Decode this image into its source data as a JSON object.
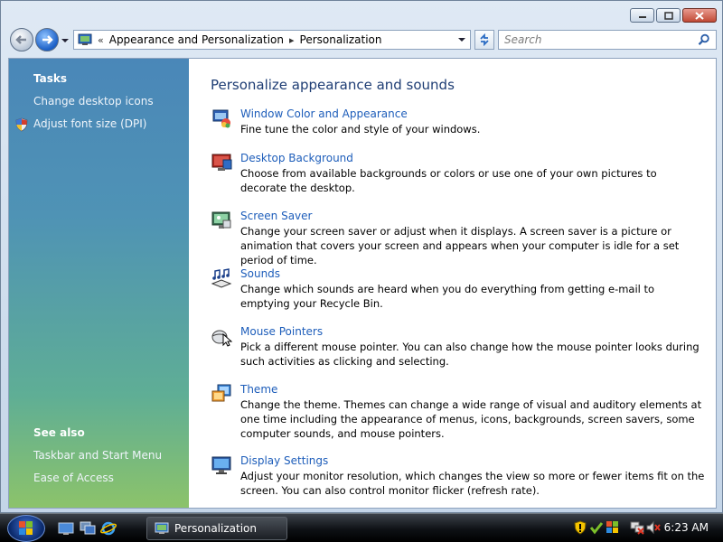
{
  "window": {
    "caption_buttons": [
      "minimize-icon",
      "maximize-icon",
      "close-icon"
    ]
  },
  "address": {
    "crumb_prefix": "«",
    "crumbs": [
      "Appearance and Personalization",
      "Personalization"
    ],
    "separator": "▸",
    "search_placeholder": "Search"
  },
  "sidebar": {
    "tasks_heading": "Tasks",
    "tasks": [
      {
        "label": "Change desktop icons",
        "icon": null
      },
      {
        "label": "Adjust font size (DPI)",
        "icon": "shield-icon"
      }
    ],
    "see_also_heading": "See also",
    "see_also": [
      {
        "label": "Taskbar and Start Menu"
      },
      {
        "label": "Ease of Access"
      }
    ]
  },
  "main": {
    "title": "Personalize appearance and sounds",
    "items": [
      {
        "title": "Window Color and Appearance",
        "desc": "Fine tune the color and style of your windows.",
        "icon": "window-color-icon"
      },
      {
        "title": "Desktop Background",
        "desc": "Choose from available backgrounds or colors or use one of your own pictures to decorate the desktop.",
        "icon": "desktop-background-icon"
      },
      {
        "title": "Screen Saver",
        "desc": "Change your screen saver or adjust when it displays. A screen saver is a picture or animation that covers your screen and appears when your computer is idle for a set period of time.",
        "icon": "screen-saver-icon"
      },
      {
        "title": "Sounds",
        "desc": "Change which sounds are heard when you do everything from getting e-mail to emptying your Recycle Bin.",
        "icon": "sounds-icon"
      },
      {
        "title": "Mouse Pointers",
        "desc": "Pick a different mouse pointer. You can also change how the mouse pointer looks during such activities as clicking and selecting.",
        "icon": "mouse-pointers-icon"
      },
      {
        "title": "Theme",
        "desc": "Change the theme. Themes can change a wide range of visual and auditory elements at one time including the appearance of menus, icons, backgrounds, screen savers, some computer sounds, and mouse pointers.",
        "icon": "theme-icon"
      },
      {
        "title": "Display Settings",
        "desc": "Adjust your monitor resolution, which changes the view so more or fewer items fit on the screen. You can also control monitor flicker (refresh rate).",
        "icon": "display-settings-icon"
      }
    ]
  },
  "taskbar": {
    "active_window": "Personalization",
    "clock": "6:23 AM",
    "quick_launch": [
      "show-desktop-icon",
      "switch-windows-icon",
      "internet-explorer-icon"
    ],
    "tray_icons": [
      "security-shield-icon",
      "windows-defender-icon",
      "security-center-icon",
      "network-icon",
      "volume-muted-icon"
    ]
  },
  "colors": {
    "link": "#1d5dba",
    "title": "#1e3d74",
    "sidebar_top": "#4a87b8",
    "sidebar_bottom": "#8cc36a"
  }
}
